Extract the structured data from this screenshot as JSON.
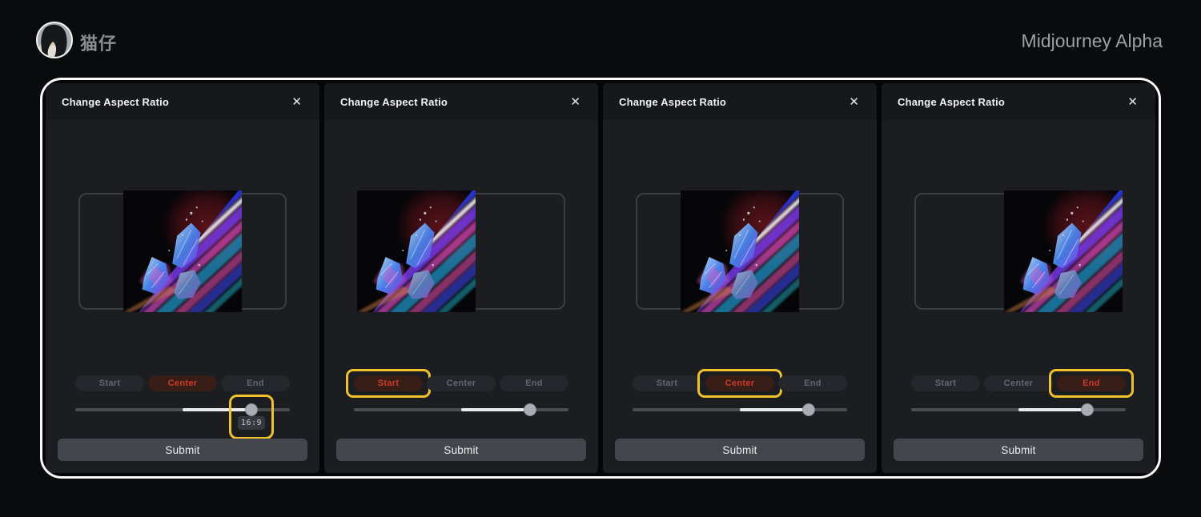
{
  "header": {
    "username": "猫仔",
    "app_title": "Midjourney Alpha"
  },
  "dialog": {
    "title": "Change Aspect Ratio",
    "close_icon": "✕",
    "options": [
      "Start",
      "Center",
      "End"
    ],
    "submit_label": "Submit"
  },
  "panels": [
    {
      "title": "Change Aspect Ratio",
      "active_option": "Center",
      "image_alignment": "center",
      "slider_percent": 82,
      "slider_tooltip": "16:9",
      "highlighted_element": "slider-handle",
      "submit_label": "Submit"
    },
    {
      "title": "Change Aspect Ratio",
      "active_option": "Start",
      "image_alignment": "start",
      "slider_percent": 82,
      "highlighted_element": "start-button",
      "submit_label": "Submit"
    },
    {
      "title": "Change Aspect Ratio",
      "active_option": "Center",
      "image_alignment": "center",
      "slider_percent": 82,
      "highlighted_element": "center-button",
      "submit_label": "Submit"
    },
    {
      "title": "Change Aspect Ratio",
      "active_option": "End",
      "image_alignment": "end",
      "slider_percent": 82,
      "highlighted_element": "end-button",
      "submit_label": "Submit"
    }
  ],
  "colors": {
    "accent_red": "#cb3b2a",
    "highlight_yellow": "#f2c22c",
    "panel_bg": "#1b1d21",
    "track_active": "#e9eaee"
  }
}
